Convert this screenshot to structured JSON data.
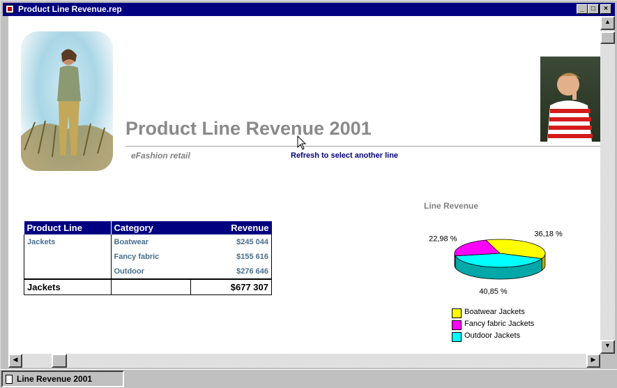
{
  "window": {
    "title": "Product Line Revenue.rep",
    "controls": {
      "minimize": "_",
      "maximize": "□",
      "close": "×"
    }
  },
  "report": {
    "title": "Product Line Revenue 2001",
    "subtitle": "eFashion  retail",
    "refresh_text": "Refresh to select another line"
  },
  "table": {
    "headers": [
      "Product Line",
      "Category",
      "Revenue"
    ],
    "rows": [
      {
        "product_line": "Jackets",
        "category": "Boatwear",
        "revenue": "$245 044"
      },
      {
        "product_line": "",
        "category": "Fancy fabric",
        "revenue": "$155 616"
      },
      {
        "product_line": "",
        "category": "Outdoor",
        "revenue": "$276 646"
      }
    ],
    "total": {
      "label": "Jackets",
      "value": "$677  307"
    }
  },
  "chart_data": {
    "type": "pie",
    "title": "Line Revenue",
    "slices": [
      {
        "name": "Boatwear Jackets",
        "percent": 36.18,
        "label": "36,18 %",
        "color": "#ffff00"
      },
      {
        "name": "Fancy fabric Jackets",
        "percent": 22.98,
        "label": "22,98 %",
        "color": "#ff00ff"
      },
      {
        "name": "Outdoor Jackets",
        "percent": 40.85,
        "label": "40,85 %",
        "color": "#00ffff"
      }
    ],
    "legend_position": "bottom"
  },
  "taskbar": {
    "tab_label": "Line Revenue 2001"
  },
  "colors": {
    "titlebar": "#000080",
    "table_header": "#000080",
    "link": "#000080"
  }
}
